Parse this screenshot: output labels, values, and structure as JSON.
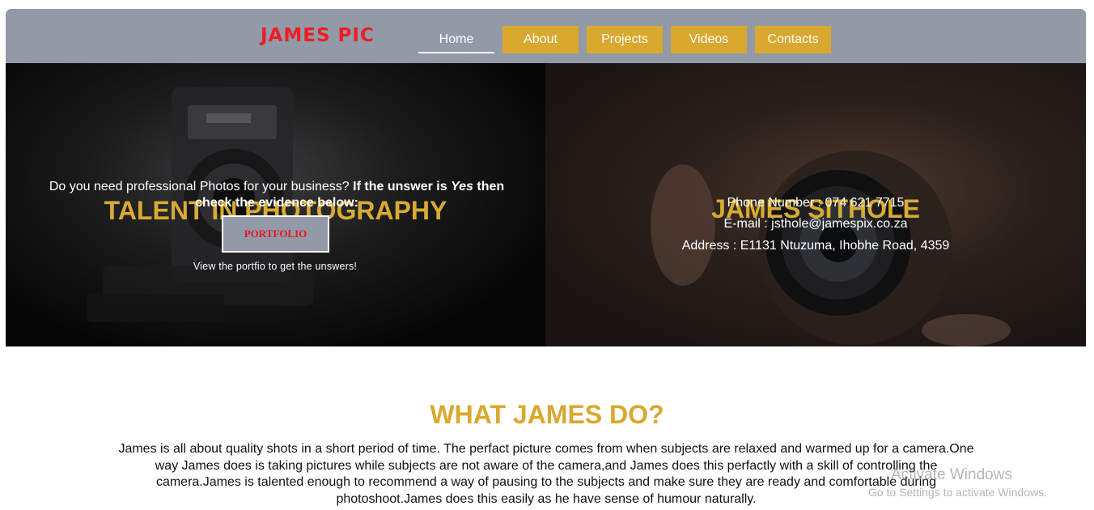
{
  "nav": {
    "logo": "JAMES PIC",
    "links": [
      "Home",
      "About",
      "Projects",
      "Videos",
      "Contacts"
    ],
    "active": "Home"
  },
  "hero_left": {
    "title": "TALENT IN PHOTOGRAPHY",
    "intro_plain": "Do you need professional Photos for your business? ",
    "intro_bold_1": "If the unswer is ",
    "intro_bold_italic": "Yes",
    "intro_bold_2": " then check the evidence below:",
    "button": "PORTFOLIO",
    "caption": "View the portfio to get the unswers!"
  },
  "hero_right": {
    "name": "JAMES SITHOLE",
    "phone": "Phone Number : 074 621 7715",
    "email": "E-mail : jsthole@jamespix.co.za",
    "address": "Address : E1131 Ntuzuma, Ihobhe Road, 4359"
  },
  "about": {
    "heading": "WHAT JAMES DO?",
    "text": "James is all about quality shots in a short period of time. The perfact picture comes from when subjects are relaxed and warmed up for a camera.One way James does is taking pictures while subjects are not aware of the camera,and James does this perfactly with a skill of controlling the camera.James is talented enough to recommend a way of pausing to the subjects and make sure they are ready and comfortable during photoshoot.James does this easily as he have sense of humour naturally."
  },
  "watermark": {
    "title": "Activate Windows",
    "subtitle": "Go to Settings to activate Windows."
  },
  "colors": {
    "nav_bg": "#929aa8",
    "accent_gold": "#d9a82e",
    "logo_red": "#ee1c24"
  }
}
